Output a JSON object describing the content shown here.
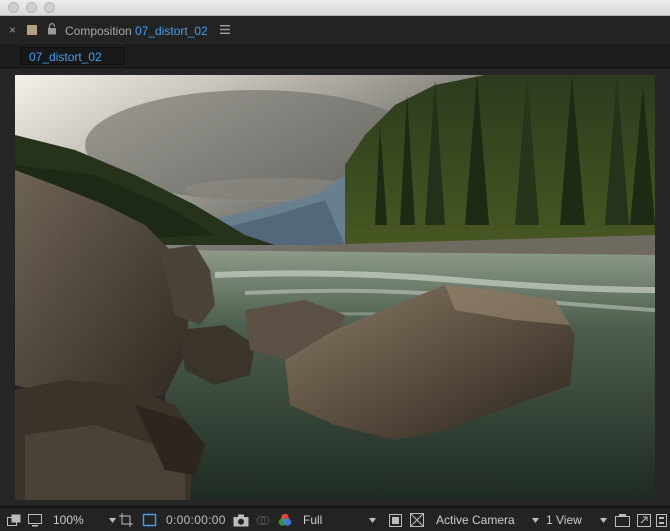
{
  "panel": {
    "composition_label": "Composition",
    "composition_name": "07_distort_02",
    "tab_label": "07_distort_02"
  },
  "toolbar": {
    "zoom": "100%",
    "timecode": "0:00:00:00",
    "resolution": "Full",
    "camera": "Active Camera",
    "views": "1 View"
  },
  "colors": {
    "accent": "#3f9ff2",
    "panel_bg": "#1d1d1d",
    "label_swatch": "#b3a27f"
  },
  "icons": [
    "close-icon",
    "label-swatch-icon",
    "lock-icon",
    "panel-menu-icon",
    "always-preview-icon",
    "monitor-icon",
    "safe-areas-icon",
    "roi-icon",
    "camera-snapshot-icon",
    "show-snapshot-icon",
    "channel-icon",
    "transparency-grid-icon",
    "toggle-mask-icon",
    "pixel-aspect-icon",
    "export-frame-icon"
  ]
}
